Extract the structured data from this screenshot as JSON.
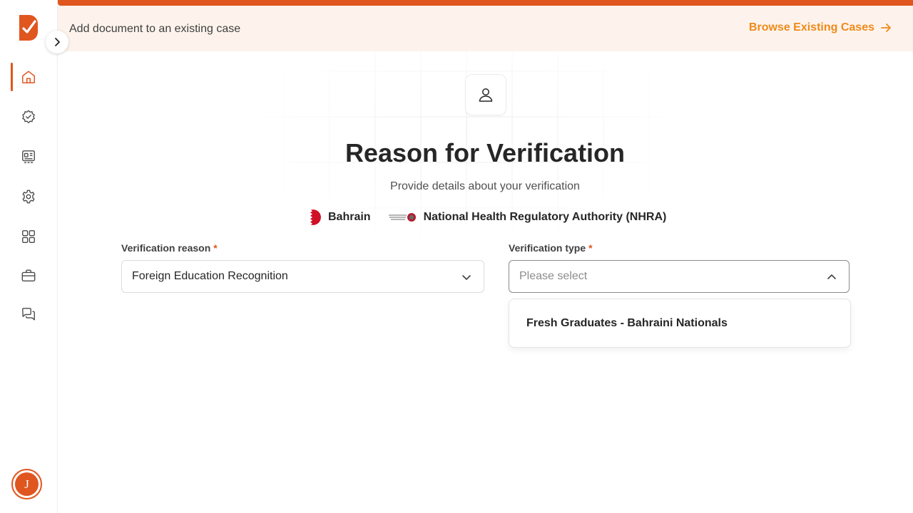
{
  "banner": {
    "text": "Add document to an existing case",
    "browse_label": "Browse Existing Cases"
  },
  "sidebar": {
    "items": [
      {
        "name": "home-icon",
        "active": true
      },
      {
        "name": "verified-badge-icon",
        "active": false
      },
      {
        "name": "id-card-icon",
        "active": false
      },
      {
        "name": "gear-icon",
        "active": false
      },
      {
        "name": "apps-grid-icon",
        "active": false
      },
      {
        "name": "briefcase-icon",
        "active": false
      },
      {
        "name": "chat-icon",
        "active": false
      }
    ],
    "avatar_initial": "J"
  },
  "header": {
    "title": "Reason for Verification",
    "subtitle": "Provide details about your verification",
    "country": "Bahrain",
    "authority": "National Health Regulatory Authority (NHRA)"
  },
  "form": {
    "reason": {
      "label": "Verification reason",
      "required_mark": "*",
      "value": "Foreign Education Recognition"
    },
    "type": {
      "label": "Verification type",
      "required_mark": "*",
      "placeholder": "Please select",
      "options": [
        "Fresh Graduates - Bahraini Nationals"
      ]
    }
  },
  "colors": {
    "accent": "#e0561f",
    "link": "#f08a19",
    "banner_bg": "#fdf3ec"
  }
}
